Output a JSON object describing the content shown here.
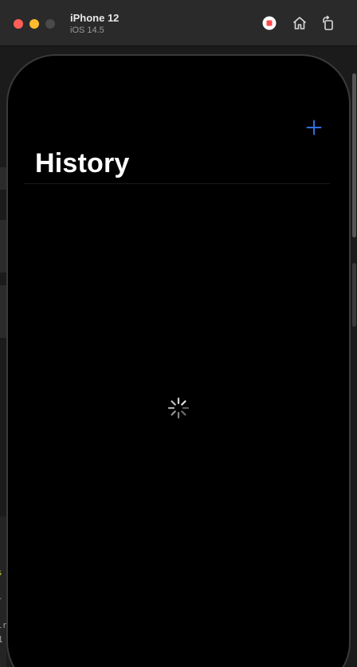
{
  "window": {
    "device_name": "iPhone 12",
    "os_version": "iOS 14.5",
    "traffic_lights": {
      "close_color": "#ff5f57",
      "minimize_color": "#febc2e",
      "zoom_color": "#4a4a4a"
    },
    "toolbar": {
      "stop_icon": "record-stop-icon",
      "stop_color": "#ff4a4a",
      "home_icon": "home-icon",
      "rotate_icon": "rotate-icon"
    }
  },
  "app": {
    "navigation": {
      "title": "History",
      "add_icon": "plus-icon",
      "accent_color": "#2f6fe0"
    },
    "content": {
      "state": "loading",
      "spinner_icon": "activity-indicator-icon"
    }
  },
  "background_fragments": {
    "left_glyph_1": "s",
    "left_glyph_2": "-",
    "left_glyph_3": "ir",
    "left_glyph_4": "1"
  }
}
